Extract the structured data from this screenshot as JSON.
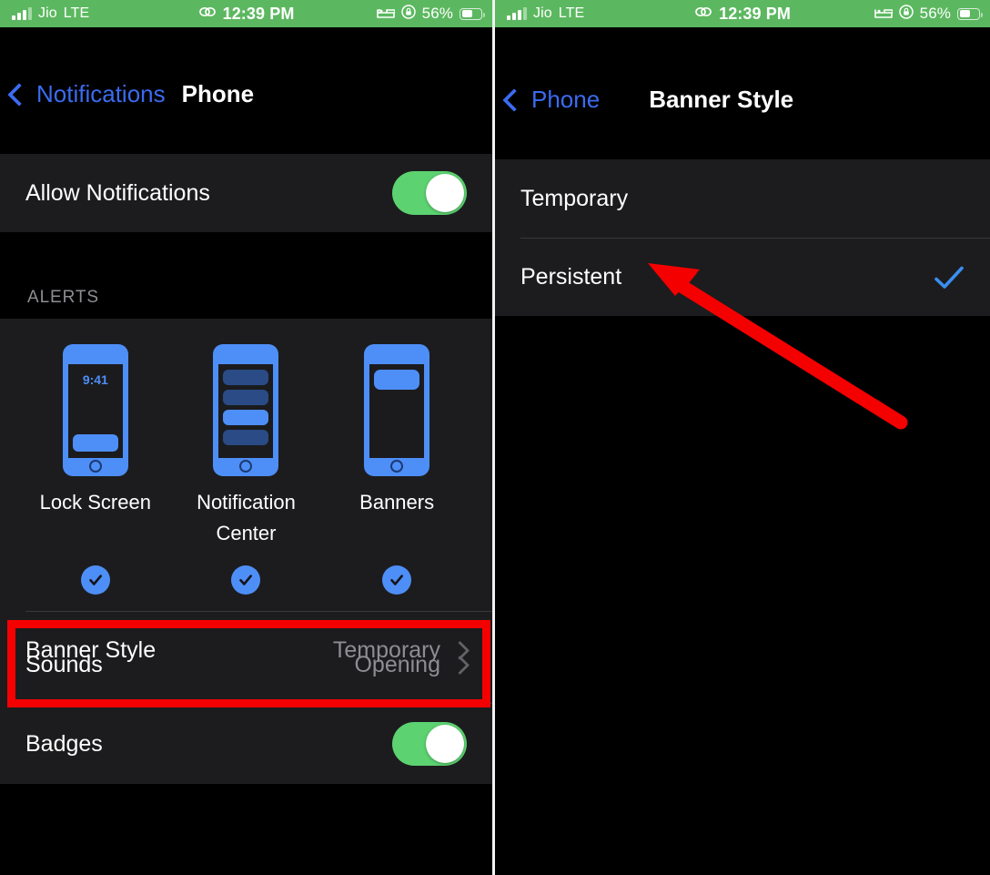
{
  "status_bar": {
    "signal_icon": "cellular-signal-icon",
    "carrier": "Jio",
    "network": "LTE",
    "link_icon": "screen-mirroring-icon",
    "time": "12:39 PM",
    "sleep_icon": "bed-icon",
    "rotation_lock_icon": "rotation-lock-icon",
    "battery_percent": "56%",
    "battery_icon": "battery-icon"
  },
  "colors": {
    "status_bar_green": "#5cb860",
    "toggle_green": "#5cd271",
    "accent_blue": "#4e8ef7",
    "link_blue": "#3b6bf0",
    "annotation_red": "#f50000",
    "card_bg": "#1c1c1e",
    "page_bg": "#000000",
    "secondary_text": "#8d8d93"
  },
  "left_panel": {
    "nav": {
      "back_icon": "chevron-left-icon",
      "back_label": "Notifications",
      "title": "Phone"
    },
    "allow_notifications": {
      "label": "Allow Notifications",
      "toggle_state": "on"
    },
    "alerts_section": {
      "header": "ALERTS",
      "styles": [
        {
          "caption": "Lock Screen",
          "icon": "lock-screen-phone-icon",
          "lock_time": "9:41",
          "selected": true,
          "check_icon": "check-icon"
        },
        {
          "caption": "Notification Center",
          "icon": "notification-center-phone-icon",
          "selected": true,
          "check_icon": "check-icon"
        },
        {
          "caption": "Banners",
          "icon": "banners-phone-icon",
          "selected": true,
          "check_icon": "check-icon"
        }
      ]
    },
    "rows": [
      {
        "label": "Banner Style",
        "value": "Temporary",
        "chevron": "chevron-right-icon",
        "highlighted": true
      },
      {
        "label": "Sounds",
        "value": "Opening",
        "chevron": "chevron-right-icon",
        "highlighted": false
      }
    ],
    "badges": {
      "label": "Badges",
      "toggle_state": "on"
    }
  },
  "right_panel": {
    "nav": {
      "back_icon": "chevron-left-icon",
      "back_label": "Phone",
      "title": "Banner Style"
    },
    "options": [
      {
        "label": "Temporary",
        "selected": false
      },
      {
        "label": "Persistent",
        "selected": true,
        "check_icon": "checkmark-icon"
      }
    ]
  },
  "annotations": {
    "highlight_box_target": "Banner Style",
    "arrow_target": "Persistent",
    "arrow_color": "#f50000"
  }
}
